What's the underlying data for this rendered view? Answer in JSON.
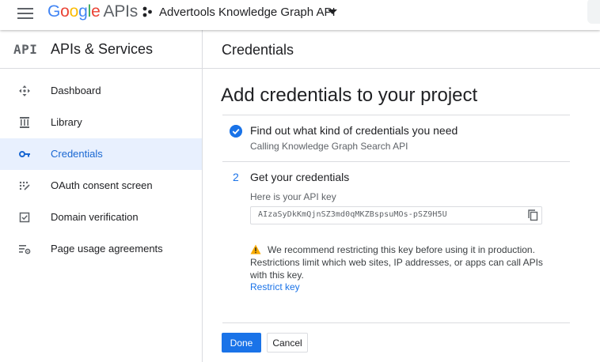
{
  "header": {
    "logo_letters": [
      "G",
      "o",
      "o",
      "g",
      "l",
      "e"
    ],
    "logo_suffix": "APIs",
    "project_name": "Advertools Knowledge Graph API",
    "icons": [
      "menu-icon",
      "project-icon",
      "chevron-down-icon"
    ]
  },
  "sidebar": {
    "api_logo": "API",
    "title": "APIs & Services",
    "items": [
      {
        "label": "Dashboard",
        "icon": "dashboard-icon",
        "active": false
      },
      {
        "label": "Library",
        "icon": "library-icon",
        "active": false
      },
      {
        "label": "Credentials",
        "icon": "key-icon",
        "active": true
      },
      {
        "label": "OAuth consent screen",
        "icon": "oauth-icon",
        "active": false
      },
      {
        "label": "Domain verification",
        "icon": "checkbox-icon",
        "active": false
      },
      {
        "label": "Page usage agreements",
        "icon": "settings-list-icon",
        "active": false
      }
    ]
  },
  "main": {
    "header_title": "Credentials",
    "page_title": "Add credentials to your project",
    "step1": {
      "title": "Find out what kind of credentials you need",
      "subtitle": "Calling Knowledge Graph Search API"
    },
    "step2": {
      "number": "2",
      "title": "Get your credentials",
      "key_label": "Here is your API key",
      "key_value": "AIzaSyDkKmQjnSZ3md0qMKZBspsuMOs-pSZ9H5U",
      "warning": "We recommend restricting this key before using it in production. Restrictions limit which web sites, IP addresses, or apps can call APIs with this key.",
      "restrict_link": "Restrict key"
    },
    "buttons": {
      "done": "Done",
      "cancel": "Cancel"
    }
  },
  "colors": {
    "accent": "#1a73e8",
    "active_bg": "#e8f0fe",
    "warning": "#f9ab00"
  }
}
